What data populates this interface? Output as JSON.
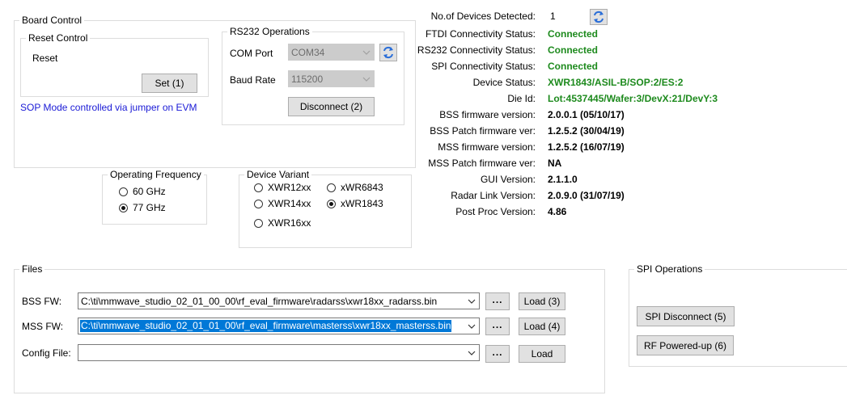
{
  "board_control": {
    "title": "Board Control",
    "reset_control": {
      "title": "Reset Control",
      "reset_label": "Reset",
      "set_button": "Set (1)"
    },
    "sop_note": "SOP Mode controlled via jumper on EVM",
    "rs232": {
      "title": "RS232 Operations",
      "com_port_label": "COM Port",
      "com_port_value": "COM34",
      "baud_rate_label": "Baud Rate",
      "baud_rate_value": "115200",
      "disconnect_button": "Disconnect (2)"
    }
  },
  "operating_frequency": {
    "title": "Operating Frequency",
    "options": [
      {
        "label": "60 GHz",
        "selected": false
      },
      {
        "label": "77 GHz",
        "selected": true
      }
    ]
  },
  "device_variant": {
    "title": "Device Variant",
    "options": [
      {
        "label": "XWR12xx",
        "selected": false
      },
      {
        "label": "xWR6843",
        "selected": false
      },
      {
        "label": "XWR14xx",
        "selected": false
      },
      {
        "label": "xWR1843",
        "selected": true
      },
      {
        "label": "XWR16xx",
        "selected": false
      }
    ]
  },
  "status": {
    "devices_detected_label": "No.of Devices Detected:",
    "devices_detected_value": "1",
    "rows": [
      {
        "label": "FTDI Connectivity Status:",
        "value": "Connected"
      },
      {
        "label": "RS232 Connectivity Status:",
        "value": "Connected"
      },
      {
        "label": "SPI Connectivity Status:",
        "value": "Connected"
      },
      {
        "label": "Device Status:",
        "value": "XWR1843/ASIL-B/SOP:2/ES:2"
      },
      {
        "label": "Die Id:",
        "value": "Lot:4537445/Wafer:3/DevX:21/DevY:3"
      },
      {
        "label": "BSS firmware version:",
        "value": "2.0.0.1 (05/10/17)"
      },
      {
        "label": "BSS Patch firmware ver:",
        "value": "1.2.5.2 (30/04/19)"
      },
      {
        "label": "MSS firmware version:",
        "value": "1.2.5.2 (16/07/19)"
      },
      {
        "label": "MSS Patch firmware ver:",
        "value": "NA"
      },
      {
        "label": "GUI Version:",
        "value": "2.1.1.0"
      },
      {
        "label": "Radar Link Version:",
        "value": "2.0.9.0 (31/07/19)"
      },
      {
        "label": "Post Proc Version:",
        "value": "4.86"
      }
    ],
    "green_color": "#1d8a1d"
  },
  "files": {
    "title": "Files",
    "bss_label": "BSS FW:",
    "bss_path": "C:\\ti\\mmwave_studio_02_01_00_00\\rf_eval_firmware\\radarss\\xwr18xx_radarss.bin",
    "mss_label": "MSS FW:",
    "mss_path": "C:\\ti\\mmwave_studio_02_01_01_00\\rf_eval_firmware\\masterss\\xwr18xx_masterss.bin",
    "config_label": "Config File:",
    "config_path": "",
    "browse_label": "...",
    "load_bss": "Load (3)",
    "load_mss": "Load (4)",
    "load_config": "Load"
  },
  "spi": {
    "title": "SPI Operations",
    "disconnect_button": "SPI Disconnect (5)",
    "powered_button": "RF Powered-up (6)"
  },
  "icons": {
    "refresh": "refresh-icon",
    "dropdown": "chevron-down-icon"
  },
  "accent_color": "#0078d7",
  "link_color": "#1a1ad6"
}
